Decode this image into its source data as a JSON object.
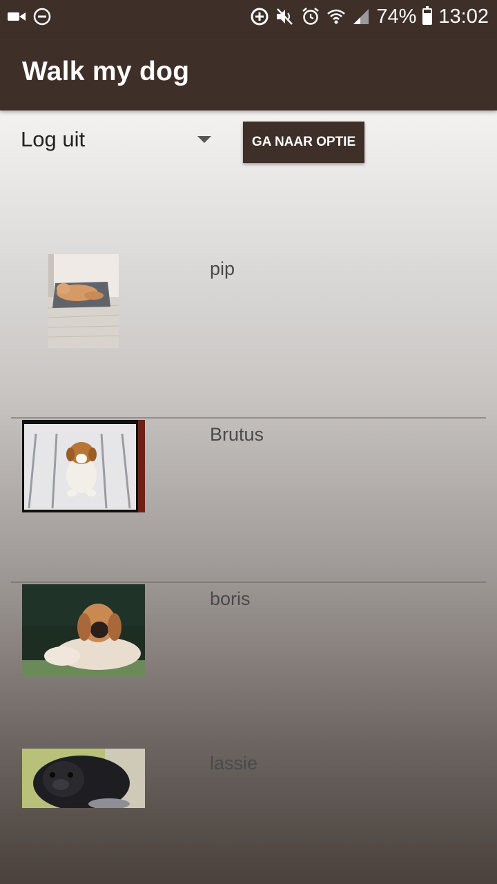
{
  "status_bar": {
    "battery_percent": "74%",
    "battery_level": 0.74,
    "time": "13:02",
    "icons": [
      "video-camera-icon",
      "do-not-disturb-icon",
      "data-saver-icon",
      "mute-icon",
      "alarm-icon",
      "wifi-icon",
      "signal-icon",
      "battery-icon"
    ]
  },
  "app_bar": {
    "title": "Walk my dog"
  },
  "controls": {
    "spinner_selected": "Log uit",
    "go_button_label": "GA NAAR OPTIE"
  },
  "dogs": [
    {
      "name": "pip"
    },
    {
      "name": "Brutus"
    },
    {
      "name": "boris"
    },
    {
      "name": "lassie"
    }
  ],
  "colors": {
    "primary": "#3e2f28",
    "text": "#222222",
    "list_text": "#4a4a4a"
  }
}
